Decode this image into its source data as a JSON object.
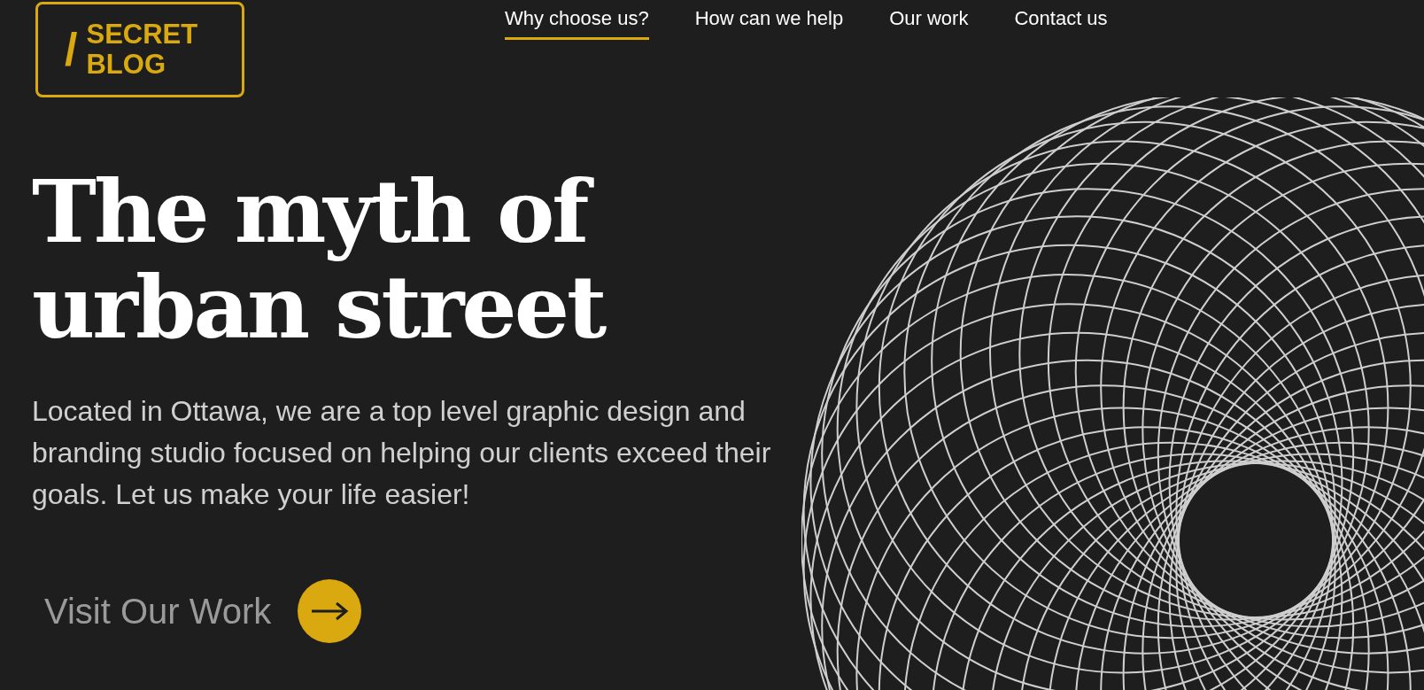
{
  "logo": {
    "mark": "/",
    "lines": [
      "SECRET",
      "BLOG"
    ]
  },
  "nav": [
    {
      "label": "Why choose us?",
      "selected": true
    },
    {
      "label": "How can we help",
      "selected": false
    },
    {
      "label": "Our work",
      "selected": false
    },
    {
      "label": "Contact us",
      "selected": false
    }
  ],
  "hero": {
    "headline": [
      "The myth of",
      "urban street"
    ],
    "text": "Located in Ottawa, we are a top level graphic design and branding studio focused on helping our clients exceed their goals. Let us make your life easier!",
    "cta": "Visit Our Work"
  }
}
